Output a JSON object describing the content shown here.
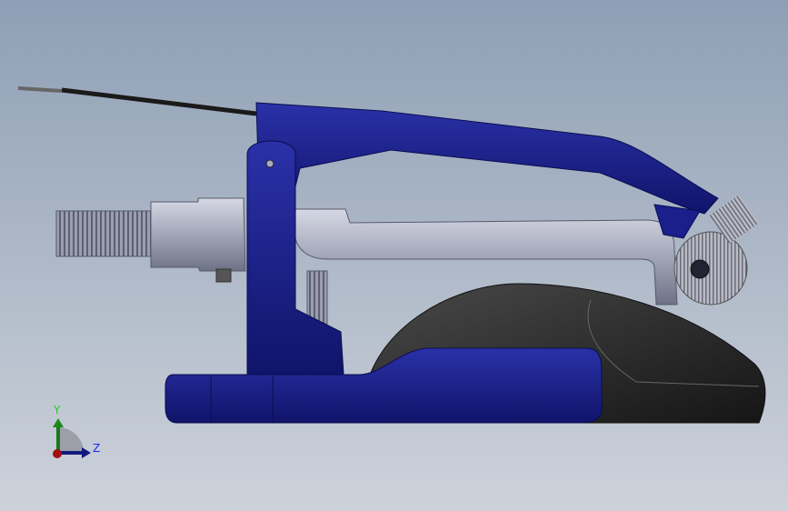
{
  "viewport": {
    "triad": {
      "y_label": "Y",
      "z_label": "Z"
    },
    "colors": {
      "background_top": "#8e9fb5",
      "background_bottom": "#cdd2da",
      "part_blue": "#1a1f8c",
      "part_silver": "#a7abbd",
      "part_black": "#2a2a2a"
    }
  }
}
